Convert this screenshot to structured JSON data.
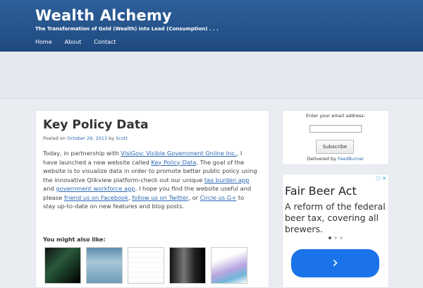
{
  "site": {
    "title": "Wealth Alchemy",
    "tagline": "The Transformation of Gold (Wealth) into Lead (Consumption) . . ."
  },
  "nav": {
    "items": [
      {
        "label": "Home"
      },
      {
        "label": "About"
      },
      {
        "label": "Contact"
      }
    ]
  },
  "post": {
    "title": "Key Policy Data",
    "meta_prefix": "Posted on",
    "date": "October 29, 2013",
    "by": "by",
    "author": "Scott",
    "p1": "Today, in partnership with",
    "link_visigov": "VisiGov: Visible Government Online Inc.",
    "p2": ", I have launched a new website called",
    "link_kpd": "Key Policy Data",
    "p3": ". The goal of the website is to visualize data in order to promote better public policy using the innovative Qlikview platform-check out our unique",
    "link_tax": "tax burden app",
    "p4": "and",
    "link_workforce": "government workforce app",
    "p5": ". I hope you find the website useful and please",
    "link_facebook": "friend us on Facebook",
    "p6": ",",
    "link_twitter": "follow us on Twitter",
    "p7": ", or",
    "link_gplus": "Circle us G+",
    "p8": "to stay up-to-date on new features and blog posts.",
    "also_label": "You might also like:"
  },
  "subscribe": {
    "label": "Enter your email address:",
    "button": "Subscribe",
    "delivered_by": "Delivered by",
    "feedburner": "FeedBurner"
  },
  "ad": {
    "badge": "ⓘ ✕",
    "title": "Fair Beer Act",
    "body": "A reform of the federal beer tax, covering all brewers.",
    "button_glyph": "›",
    "button_color": "#1a73e8"
  },
  "colors": {
    "header": "#1f4a80",
    "link": "#2f69b3"
  }
}
